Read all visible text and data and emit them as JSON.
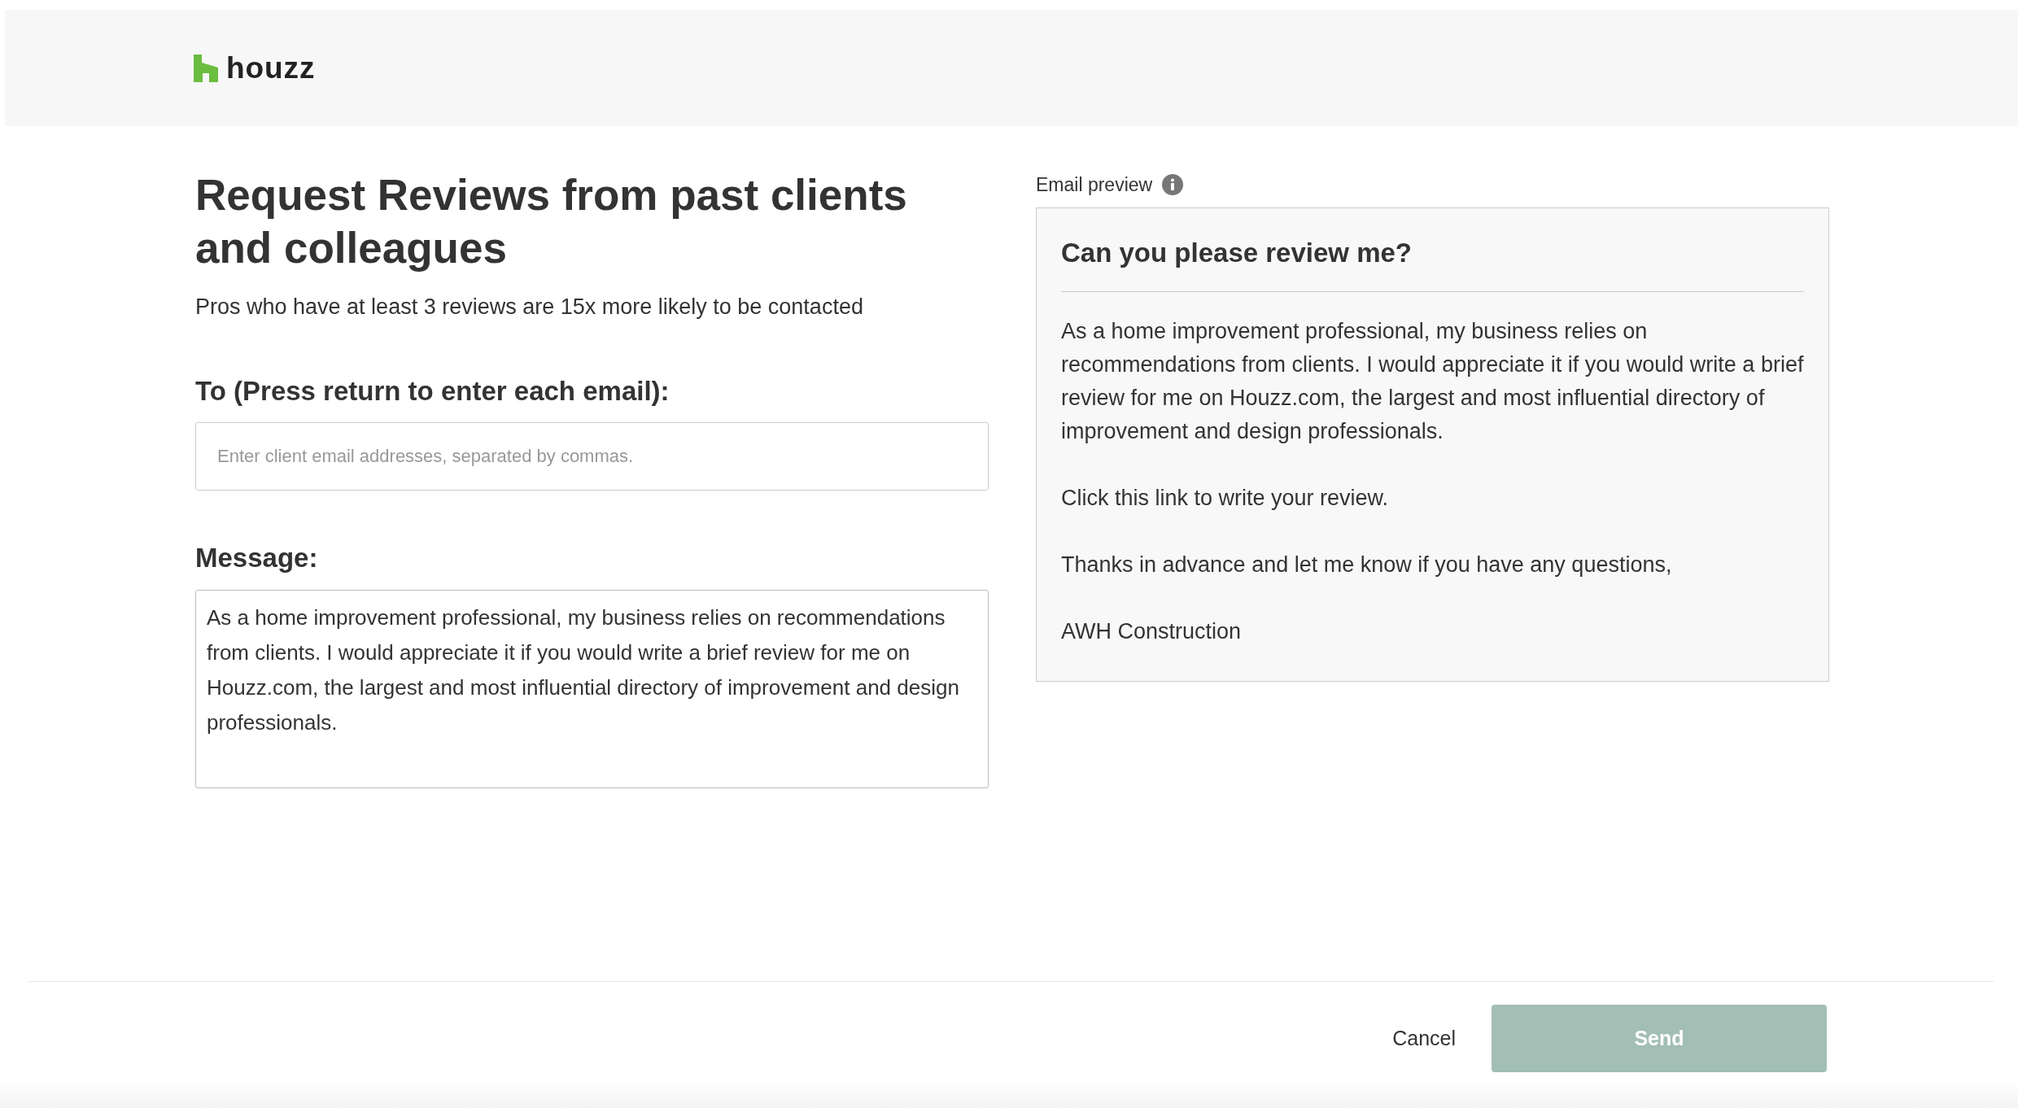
{
  "header": {
    "logo_text": "houzz"
  },
  "form": {
    "title": "Request Reviews from past clients and colleagues",
    "subtitle": "Pros who have at least 3 reviews are 15x more likely to be contacted",
    "to_label": "To (Press return to enter each email):",
    "to_field": {
      "placeholder": "Enter client email addresses, separated by commas."
    },
    "message_label": "Message:",
    "message_field": {
      "value": "As a home improvement professional, my business relies on recommendations from clients. I would appreciate it if you would write a brief review for me on Houzz.com, the largest and most influential directory of improvement and design professionals."
    }
  },
  "preview": {
    "label": "Email preview",
    "heading": "Can you please review me?",
    "paragraphs": [
      "As a home improvement professional, my business relies on recommendations from clients. I would appreciate it if you would write a brief review for me on Houzz.com, the largest and most influential directory of improvement and design professionals.",
      "Click this link to write your review.",
      "Thanks in advance and let me know if you have any questions,",
      "AWH Construction"
    ]
  },
  "footer": {
    "cancel": "Cancel",
    "send": {
      "label": "Send",
      "disabled": true
    }
  }
}
